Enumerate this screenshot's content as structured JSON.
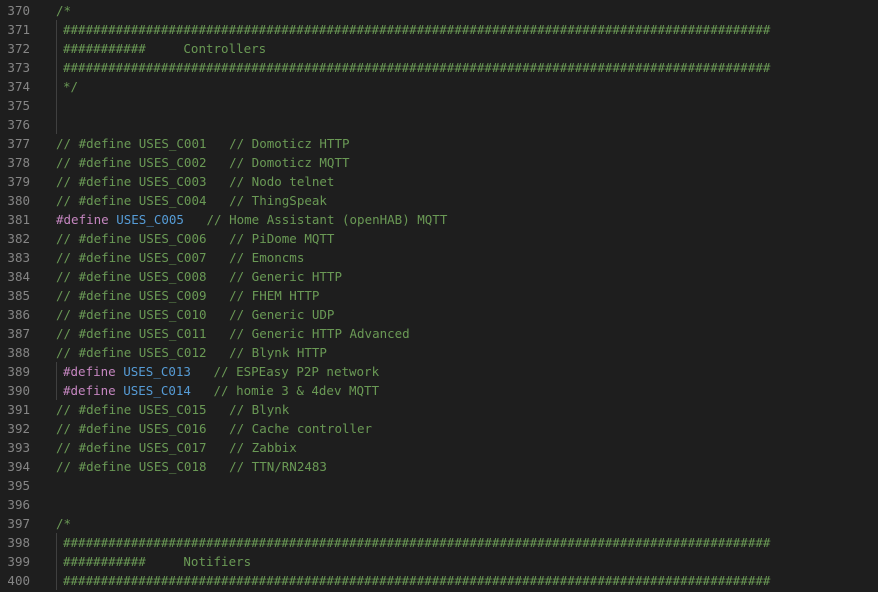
{
  "editor": {
    "lines": [
      {
        "num": "370",
        "indent": false,
        "tokens": [
          {
            "t": "comment",
            "v": "/*"
          }
        ]
      },
      {
        "num": "371",
        "indent": true,
        "tokens": [
          {
            "t": "comment",
            "v": "##############################################################################################"
          }
        ]
      },
      {
        "num": "372",
        "indent": true,
        "tokens": [
          {
            "t": "comment",
            "v": "###########     Controllers"
          }
        ]
      },
      {
        "num": "373",
        "indent": true,
        "tokens": [
          {
            "t": "comment",
            "v": "##############################################################################################"
          }
        ]
      },
      {
        "num": "374",
        "indent": true,
        "tokens": [
          {
            "t": "comment",
            "v": "*/"
          }
        ]
      },
      {
        "num": "375",
        "indent": true,
        "tokens": []
      },
      {
        "num": "376",
        "indent": true,
        "tokens": []
      },
      {
        "num": "377",
        "indent": false,
        "tokens": [
          {
            "t": "comment",
            "v": "// #define USES_C001   // Domoticz HTTP"
          }
        ]
      },
      {
        "num": "378",
        "indent": false,
        "tokens": [
          {
            "t": "comment",
            "v": "// #define USES_C002   // Domoticz MQTT"
          }
        ]
      },
      {
        "num": "379",
        "indent": false,
        "tokens": [
          {
            "t": "comment",
            "v": "// #define USES_C003   // Nodo telnet"
          }
        ]
      },
      {
        "num": "380",
        "indent": false,
        "tokens": [
          {
            "t": "comment",
            "v": "// #define USES_C004   // ThingSpeak"
          }
        ]
      },
      {
        "num": "381",
        "indent": false,
        "tokens": [
          {
            "t": "directive",
            "v": "#define"
          },
          {
            "t": "plain",
            "v": " "
          },
          {
            "t": "macro",
            "v": "USES_C005"
          },
          {
            "t": "plain",
            "v": "   "
          },
          {
            "t": "comment",
            "v": "// Home Assistant (openHAB) MQTT"
          }
        ]
      },
      {
        "num": "382",
        "indent": false,
        "tokens": [
          {
            "t": "comment",
            "v": "// #define USES_C006   // PiDome MQTT"
          }
        ]
      },
      {
        "num": "383",
        "indent": false,
        "tokens": [
          {
            "t": "comment",
            "v": "// #define USES_C007   // Emoncms"
          }
        ]
      },
      {
        "num": "384",
        "indent": false,
        "tokens": [
          {
            "t": "comment",
            "v": "// #define USES_C008   // Generic HTTP"
          }
        ]
      },
      {
        "num": "385",
        "indent": false,
        "tokens": [
          {
            "t": "comment",
            "v": "// #define USES_C009   // FHEM HTTP"
          }
        ]
      },
      {
        "num": "386",
        "indent": false,
        "tokens": [
          {
            "t": "comment",
            "v": "// #define USES_C010   // Generic UDP"
          }
        ]
      },
      {
        "num": "387",
        "indent": false,
        "tokens": [
          {
            "t": "comment",
            "v": "// #define USES_C011   // Generic HTTP Advanced"
          }
        ]
      },
      {
        "num": "388",
        "indent": false,
        "tokens": [
          {
            "t": "comment",
            "v": "// #define USES_C012   // Blynk HTTP"
          }
        ]
      },
      {
        "num": "389",
        "indent": true,
        "tokens": [
          {
            "t": "directive",
            "v": "#define"
          },
          {
            "t": "plain",
            "v": " "
          },
          {
            "t": "macro",
            "v": "USES_C013"
          },
          {
            "t": "plain",
            "v": "   "
          },
          {
            "t": "comment",
            "v": "// ESPEasy P2P network"
          }
        ]
      },
      {
        "num": "390",
        "indent": true,
        "tokens": [
          {
            "t": "directive",
            "v": "#define"
          },
          {
            "t": "plain",
            "v": " "
          },
          {
            "t": "macro",
            "v": "USES_C014"
          },
          {
            "t": "plain",
            "v": "   "
          },
          {
            "t": "comment",
            "v": "// homie 3 & 4dev MQTT"
          }
        ]
      },
      {
        "num": "391",
        "indent": false,
        "tokens": [
          {
            "t": "comment",
            "v": "// #define USES_C015   // Blynk"
          }
        ]
      },
      {
        "num": "392",
        "indent": false,
        "tokens": [
          {
            "t": "comment",
            "v": "// #define USES_C016   // Cache controller"
          }
        ]
      },
      {
        "num": "393",
        "indent": false,
        "tokens": [
          {
            "t": "comment",
            "v": "// #define USES_C017   // Zabbix"
          }
        ]
      },
      {
        "num": "394",
        "indent": false,
        "tokens": [
          {
            "t": "comment",
            "v": "// #define USES_C018   // TTN/RN2483"
          }
        ]
      },
      {
        "num": "395",
        "indent": false,
        "tokens": []
      },
      {
        "num": "396",
        "indent": false,
        "tokens": []
      },
      {
        "num": "397",
        "indent": false,
        "tokens": [
          {
            "t": "comment",
            "v": "/*"
          }
        ]
      },
      {
        "num": "398",
        "indent": true,
        "tokens": [
          {
            "t": "comment",
            "v": "##############################################################################################"
          }
        ]
      },
      {
        "num": "399",
        "indent": true,
        "tokens": [
          {
            "t": "comment",
            "v": "###########     Notifiers"
          }
        ]
      },
      {
        "num": "400",
        "indent": true,
        "tokens": [
          {
            "t": "comment",
            "v": "##############################################################################################"
          }
        ]
      }
    ]
  }
}
